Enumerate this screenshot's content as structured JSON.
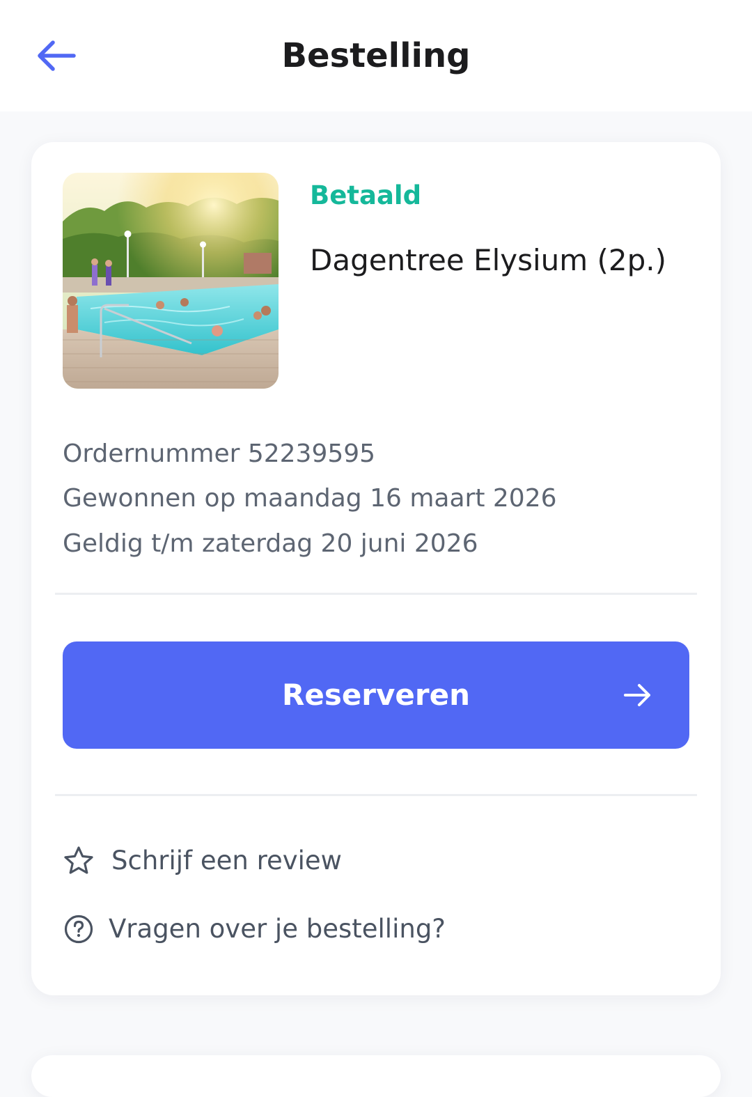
{
  "header": {
    "title": "Bestelling",
    "back_icon": "arrow-left-icon"
  },
  "order": {
    "status": "Betaald",
    "product_name": "Dagentree Elysium (2p.)",
    "image": "outdoor-pool-photo",
    "order_number": "Ordernummer 52239595",
    "won_on": "Gewonnen op maandag 16 maart 2026",
    "valid_until": "Geldig t/m zaterdag 20 juni 2026"
  },
  "cta": {
    "label": "Reserveren",
    "icon": "arrow-right-icon"
  },
  "links": [
    {
      "label": "Schrijf een review",
      "icon": "star-outline-icon"
    },
    {
      "label": "Vragen over je bestelling?",
      "icon": "question-circle-icon"
    }
  ],
  "colors": {
    "accent": "#5168f4",
    "status_paid": "#15b89a",
    "title_text": "#1c1c1e",
    "secondary_text": "#5d6572",
    "background": "#f8f9fb"
  }
}
